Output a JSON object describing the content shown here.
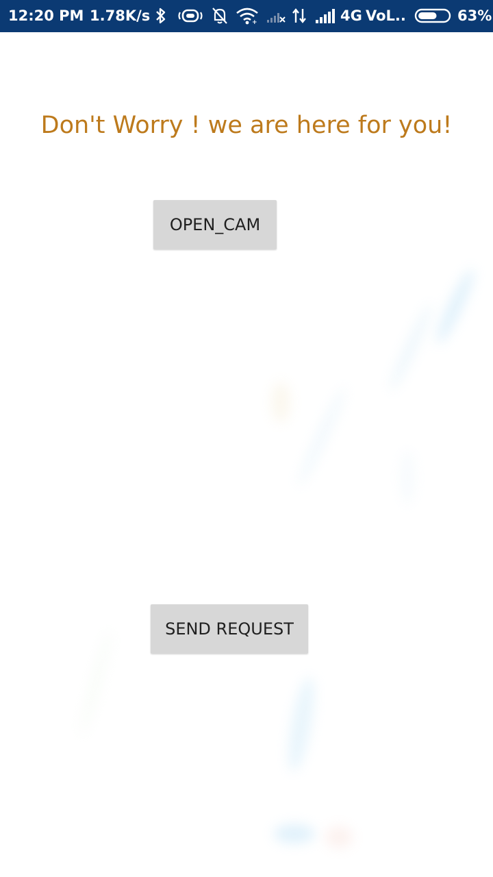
{
  "status_bar": {
    "time": "12:20 PM",
    "net_speed": "1.78K/s",
    "network_type": "4G",
    "carrier": "VoL..",
    "battery_percent": "63%",
    "battery_level": 0.63,
    "icons": [
      "bluetooth-icon",
      "vibrate-icon",
      "silent-bell-icon",
      "wifi-icon",
      "no-signal-icon",
      "data-arrows-icon",
      "signal-icon",
      "battery-icon"
    ],
    "background_color": "#0b3a73"
  },
  "main": {
    "headline": "Don't Worry ! we are here for you!",
    "headline_color": "#bd7a1c",
    "open_cam_label": "OPEN_CAM",
    "send_request_label": "SEND REQUEST"
  }
}
